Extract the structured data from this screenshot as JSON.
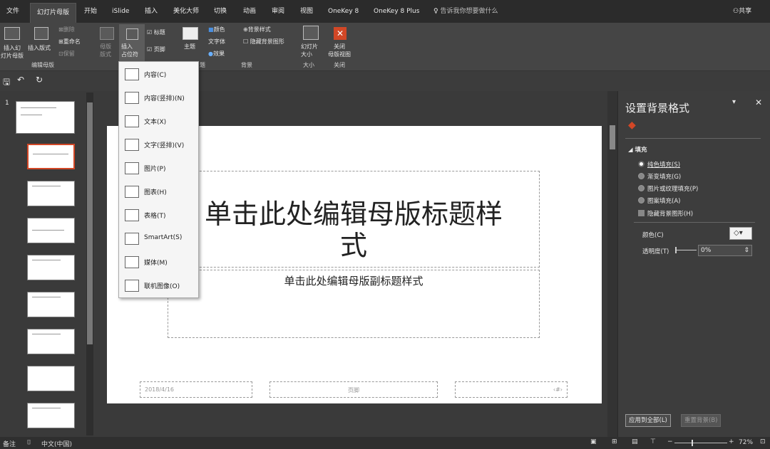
{
  "tabs": [
    "文件",
    "幻灯片母版",
    "开始",
    "iSlide",
    "插入",
    "美化大师",
    "切换",
    "动画",
    "审阅",
    "视图",
    "OneKey 8",
    "OneKey 8 Plus"
  ],
  "tell_me": "告诉我你想要做什么",
  "share": "共享",
  "ribbon": {
    "insert_master": "插入幻\n灯片母版",
    "insert_layout": "插入版式",
    "delete": "删除",
    "rename": "重命名",
    "preserve": "保留",
    "master_layout": "母版\n版式",
    "insert_placeholder": "插入\n占位符",
    "title_cb": "标题",
    "footer_cb": "页脚",
    "theme": "主题",
    "colors": "颜色",
    "fonts": "字体",
    "effects": "效果",
    "bg_styles": "背景样式",
    "hide_bg": "隐藏背景图形",
    "slide_size": "幻灯片\n大小",
    "close": "关闭\n母版视图",
    "group_edit": "编辑母版",
    "group_theme": "题",
    "group_bg": "背景",
    "group_size": "大小",
    "group_close": "关闭"
  },
  "dropdown": [
    {
      "label": "内容(C)",
      "icon": "content-icon"
    },
    {
      "label": "内容(竖排)(N)",
      "icon": "content-vertical-icon"
    },
    {
      "label": "文本(X)",
      "icon": "text-icon"
    },
    {
      "label": "文字(竖排)(V)",
      "icon": "text-vertical-icon"
    },
    {
      "label": "图片(P)",
      "icon": "picture-icon"
    },
    {
      "label": "图表(H)",
      "icon": "chart-icon"
    },
    {
      "label": "表格(T)",
      "icon": "table-icon"
    },
    {
      "label": "SmartArt(S)",
      "icon": "smartart-icon"
    },
    {
      "label": "媒体(M)",
      "icon": "media-icon"
    },
    {
      "label": "联机图像(O)",
      "icon": "online-image-icon"
    }
  ],
  "slide_number": "1",
  "slide": {
    "title": "单击此处编辑母版标题样\n式",
    "subtitle": "单击此处编辑母版副标题样式",
    "date": "2018/4/16",
    "footer": "页脚",
    "number": "‹#›"
  },
  "panel": {
    "title": "设置背景格式",
    "fill_header": "填充",
    "options": [
      "纯色填充(S)",
      "渐变填充(G)",
      "图片或纹理填充(P)",
      "图案填充(A)"
    ],
    "hide_bg": "隐藏背景图形(H)",
    "color_label": "颜色(C)",
    "transparency_label": "透明度(T)",
    "transparency_value": "0%",
    "apply_all": "应用到全部(L)",
    "reset": "重置背景(B)"
  },
  "status": {
    "notes": "备注",
    "language": "中文(中国)",
    "zoom": "72%"
  },
  "colors": {
    "accent": "#d24726"
  }
}
